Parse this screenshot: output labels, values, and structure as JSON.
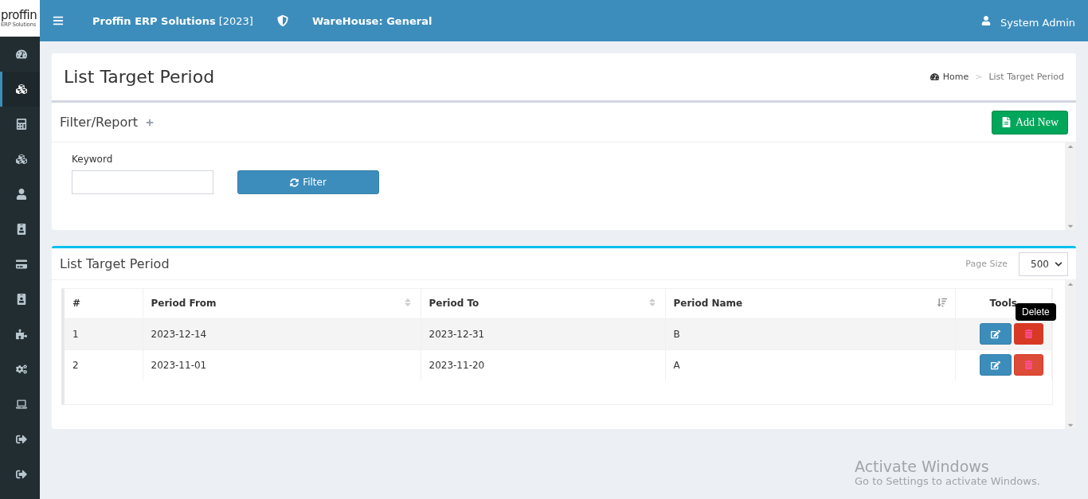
{
  "logo": {
    "text": "proffin",
    "tagline": "ERP Solutions"
  },
  "header": {
    "app_name": "Proffin ERP Solutions",
    "year": "[2023]",
    "warehouse": "WareHouse: General",
    "user": "System Admin"
  },
  "sidebar": {
    "items": [
      {
        "selected": false
      },
      {
        "selected": true
      },
      {
        "selected": false
      },
      {
        "selected": false
      },
      {
        "selected": false
      },
      {
        "selected": false
      },
      {
        "selected": false
      },
      {
        "selected": false
      },
      {
        "selected": false
      },
      {
        "selected": false
      },
      {
        "selected": false
      },
      {
        "selected": false
      },
      {
        "selected": false
      }
    ]
  },
  "page": {
    "title": "List Target Period",
    "breadcrumb": [
      "Home",
      "List Target Period"
    ],
    "separator": ">"
  },
  "filter": {
    "title": "Filter/Report",
    "add_button": "Add New",
    "keyword_label": "Keyword",
    "filter_button": "Filter"
  },
  "list": {
    "title": "List Target Period",
    "page_size_label": "Page Size",
    "page_size": "500",
    "columns": [
      {
        "label": "#",
        "kind": "plain"
      },
      {
        "label": "Period From",
        "kind": "sortable"
      },
      {
        "label": "Period To",
        "kind": "sortable"
      },
      {
        "label": "Period Name",
        "kind": "sorted"
      },
      {
        "label": "Tools",
        "kind": "plain"
      }
    ],
    "rows": [
      {
        "cells": [
          "1",
          "2023-12-14",
          "2023-12-31",
          "B"
        ],
        "hovered": true
      },
      {
        "cells": [
          "2",
          "2023-11-01",
          "2023-11-20",
          "A"
        ],
        "hovered": false
      }
    ],
    "tooltip": "Delete"
  },
  "os_notice": {
    "title": "Activate Windows",
    "text": "Go to Settings to activate Windows."
  }
}
